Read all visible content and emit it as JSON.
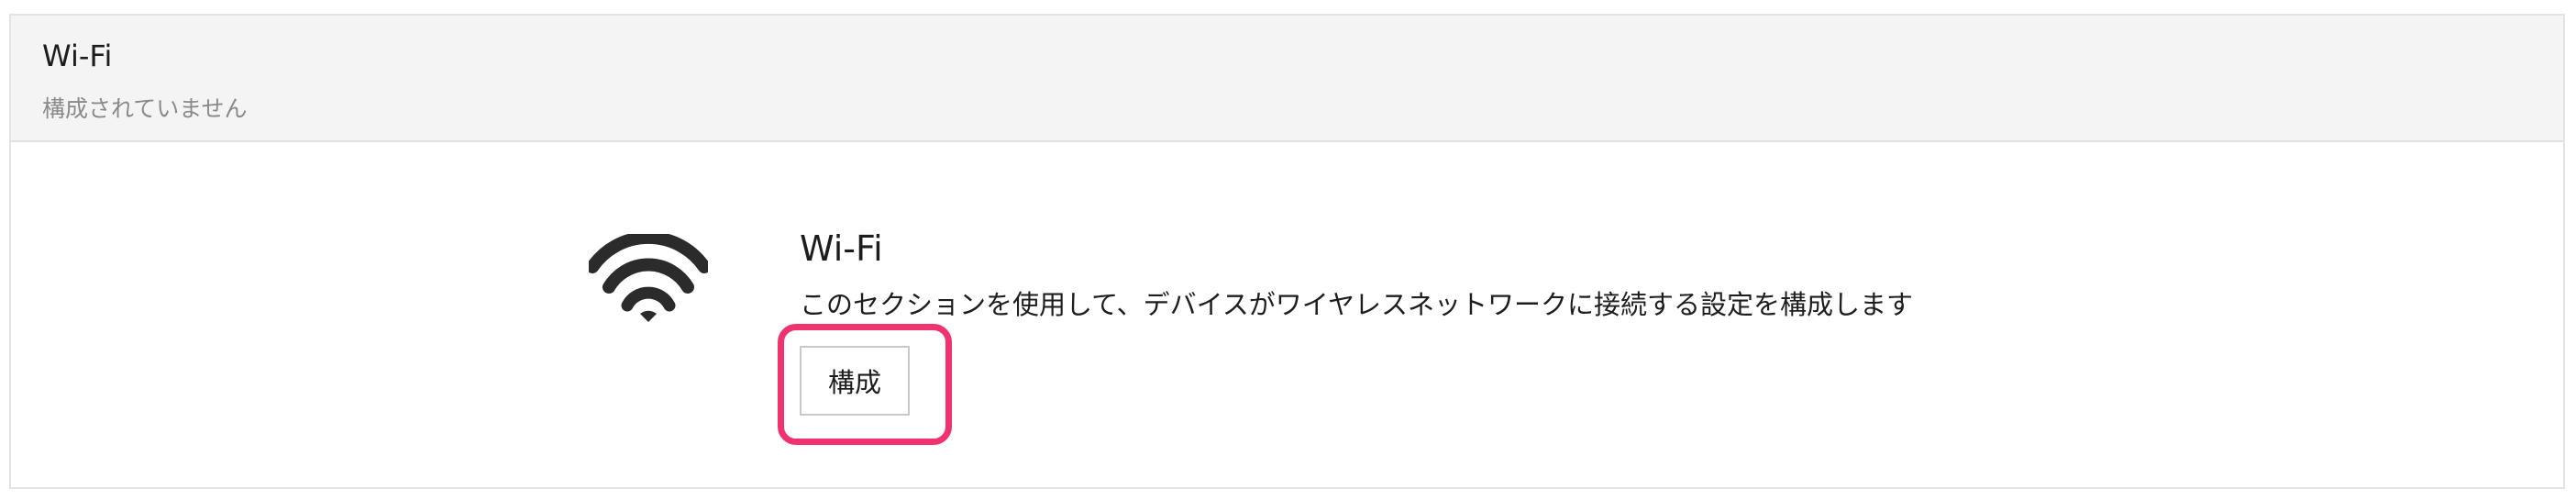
{
  "header": {
    "title": "Wi-Fi",
    "subtitle": "構成されていません"
  },
  "section": {
    "icon": "wifi-icon",
    "title": "Wi-Fi",
    "description": "このセクションを使用して、デバイスがワイヤレスネットワークに接続する設定を構成します",
    "button_label": "構成"
  },
  "colors": {
    "header_background": "#f4f4f4",
    "border": "#e3e3e3",
    "highlight": "#f0336f",
    "subtitle_text": "#8a8a8a",
    "text": "#1d1d1d"
  }
}
